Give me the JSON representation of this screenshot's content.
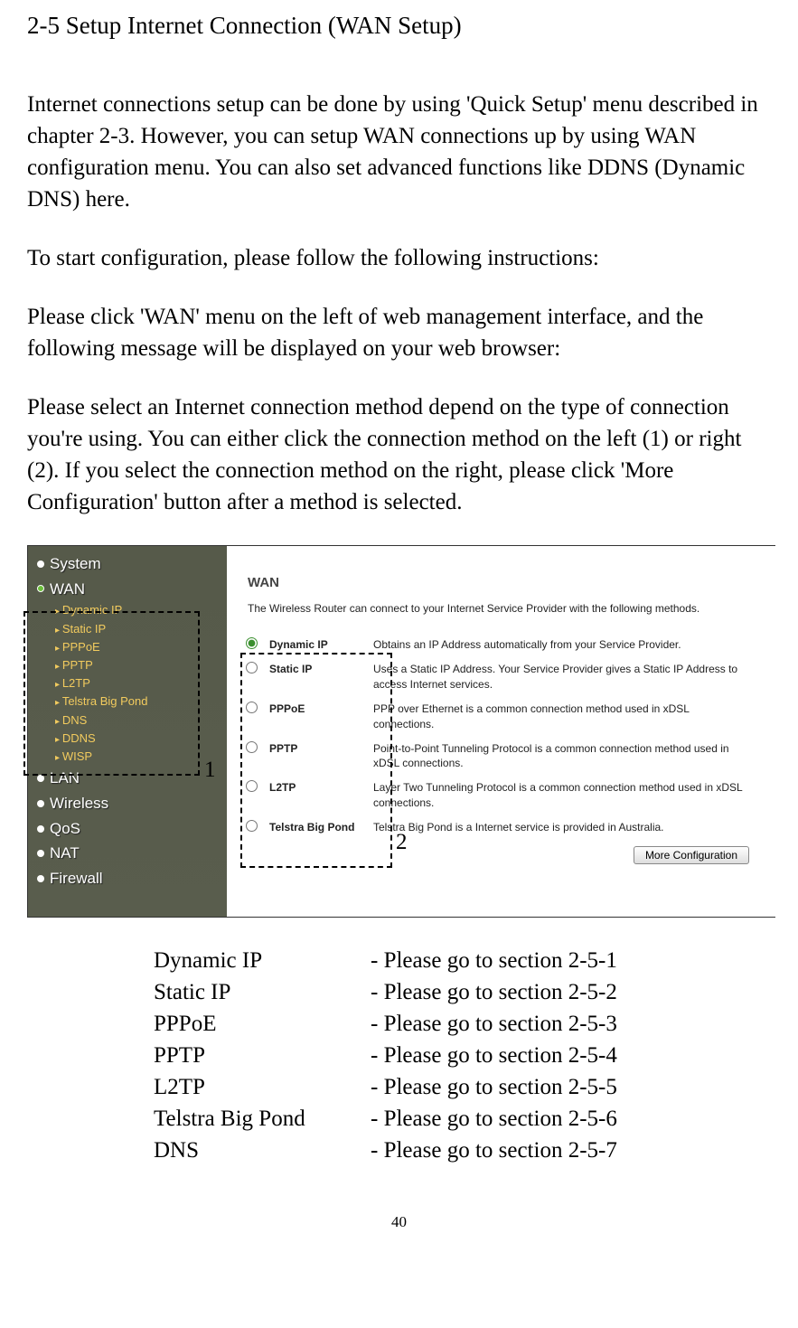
{
  "heading": "2-5 Setup Internet Connection (WAN Setup)",
  "para1": "Internet connections setup can be done by using 'Quick Setup' menu described in chapter 2-3. However, you can setup WAN connections up by using WAN configuration menu. You can also set advanced functions like DDNS (Dynamic DNS) here.",
  "para2": "To start configuration, please follow the following instructions:",
  "para3": "Please click 'WAN' menu on the left of web management interface, and the following message will be displayed on your web browser:",
  "para4": "Please select an Internet connection method depend on the type of connection you're using. You can either click the connection method on the left (1) or right (2). If you select the connection method on the right, please click 'More Configuration' button after a method is selected.",
  "callout1": "1",
  "callout2": "2",
  "sidebar": {
    "system": "System",
    "wan": "WAN",
    "subitems": [
      "Dynamic IP",
      "Static IP",
      "PPPoE",
      "PPTP",
      "L2TP",
      "Telstra Big Pond",
      "DNS",
      "DDNS",
      "WISP"
    ],
    "lan": "LAN",
    "wireless": "Wireless",
    "qos": "QoS",
    "nat": "NAT",
    "firewall": "Firewall"
  },
  "wan_panel": {
    "title": "WAN",
    "desc": "The Wireless Router can connect to your Internet Service Provider with the following methods.",
    "options": [
      {
        "label": "Dynamic IP",
        "text": "Obtains an IP Address automatically from your Service Provider.",
        "checked": true
      },
      {
        "label": "Static IP",
        "text": "Uses a Static IP Address. Your Service Provider gives a Static IP Address to access Internet services.",
        "checked": false
      },
      {
        "label": "PPPoE",
        "text": "PPP over Ethernet is a common connection method used in xDSL connections.",
        "checked": false
      },
      {
        "label": "PPTP",
        "text": "Point-to-Point Tunneling Protocol is a common connection method used in xDSL connections.",
        "checked": false
      },
      {
        "label": "L2TP",
        "text": "Layer Two Tunneling Protocol is a common connection method used in xDSL connections.",
        "checked": false
      },
      {
        "label": "Telstra Big Pond",
        "text": "Telstra Big Pond is a Internet service is provided in Australia.",
        "checked": false
      }
    ],
    "button": "More Configuration"
  },
  "refs": [
    {
      "name": "Dynamic IP",
      "text": "- Please go to section 2-5-1"
    },
    {
      "name": "Static IP",
      "text": "- Please go to section 2-5-2"
    },
    {
      "name": "PPPoE",
      "text": "- Please go to section 2-5-3"
    },
    {
      "name": "PPTP",
      "text": "- Please go to section 2-5-4"
    },
    {
      "name": "L2TP",
      "text": "- Please go to section 2-5-5"
    },
    {
      "name": "Telstra Big Pond",
      "text": "- Please go to section 2-5-6"
    },
    {
      "name": "DNS",
      "text": "- Please go to section 2-5-7"
    }
  ],
  "page_number": "40"
}
